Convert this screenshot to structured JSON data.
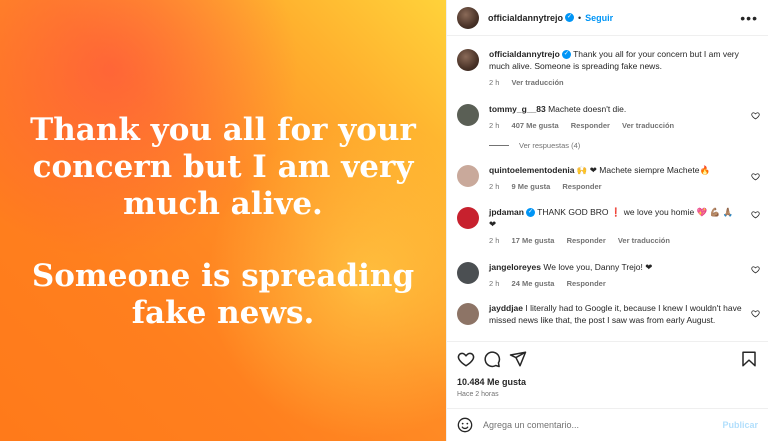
{
  "post_image": {
    "line1": "Thank you all for your concern but I am very much alive.",
    "line2": "Someone is spreading fake news."
  },
  "header": {
    "username": "officialdannytrejo",
    "separator": "•",
    "follow_label": "Seguir",
    "more_icon": "more-horizontal-icon"
  },
  "caption": {
    "username": "officialdannytrejo",
    "text": "Thank you all for your concern but I am very much alive. Someone is spreading fake news.",
    "time": "2 h",
    "translate": "Ver traducción"
  },
  "comments": [
    {
      "username": "tommy_g__83",
      "text": "Machete doesn't die.",
      "time": "2 h",
      "likes": "407 Me gusta",
      "reply": "Responder",
      "translate": "Ver traducción",
      "avatar_color": "#5a5f55"
    },
    {
      "username": "quintoelementodenia",
      "text": "🙌 ❤ Machete siempre Machete🔥",
      "time": "2 h",
      "likes": "9 Me gusta",
      "reply": "Responder",
      "translate": "",
      "avatar_color": "#c9a99b"
    },
    {
      "username": "jpdaman",
      "text": "THANK GOD BRO ❗ we love you homie 💖 💪🏽 🙏🏽 ❤",
      "time": "2 h",
      "likes": "17 Me gusta",
      "reply": "Responder",
      "translate": "Ver traducción",
      "avatar_color": "#c7212e"
    },
    {
      "username": "jangeloreyes",
      "text": "We love you, Danny Trejo! ❤",
      "time": "2 h",
      "likes": "24 Me gusta",
      "reply": "Responder",
      "translate": "",
      "avatar_color": "#4b4f52"
    },
    {
      "username": "jayddjae",
      "text": "I literally had to Google it, because I knew I wouldn't have missed news like that, the post I saw was from early August.",
      "time": "",
      "likes": "",
      "reply": "",
      "translate": "",
      "avatar_color": "#8d7466"
    }
  ],
  "view_replies": "Ver respuestas (4)",
  "likes_count": "10.484 Me gusta",
  "posted_ago": "Hace 2 horas",
  "add_comment": {
    "placeholder": "Agrega un comentario...",
    "publish_label": "Publicar"
  },
  "colors": {
    "accent": "#0095f6",
    "muted": "#737373",
    "heart_red": "#ed4956"
  }
}
